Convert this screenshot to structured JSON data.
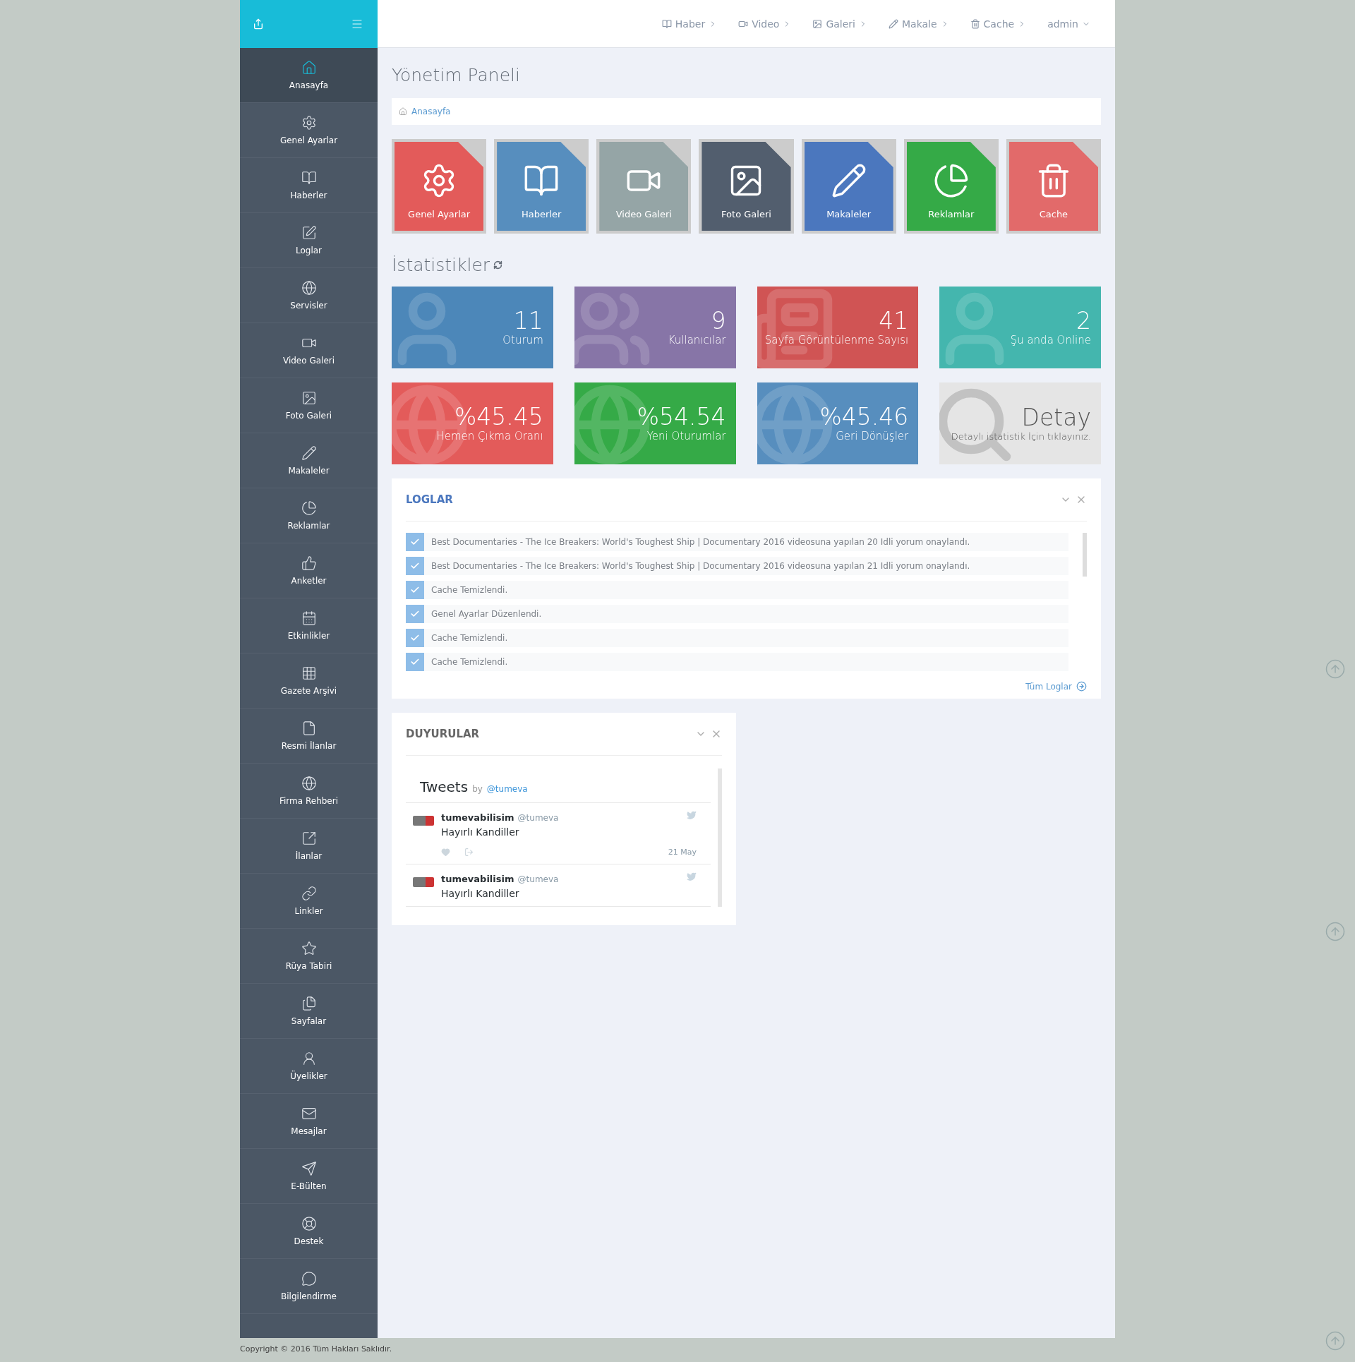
{
  "topnav": [
    {
      "label": "Haber"
    },
    {
      "label": "Video"
    },
    {
      "label": "Galeri"
    },
    {
      "label": "Makale"
    },
    {
      "label": "Cache"
    }
  ],
  "user_menu": {
    "label": "admin"
  },
  "sidebar": {
    "items": [
      {
        "label": "Anasayfa",
        "selected": true
      },
      {
        "label": "Genel Ayarlar",
        "selected": false
      },
      {
        "label": "Haberler",
        "selected": false
      },
      {
        "label": "Loglar",
        "selected": false
      },
      {
        "label": "Servisler",
        "selected": false
      },
      {
        "label": "Video Galeri",
        "selected": false
      },
      {
        "label": "Foto Galeri",
        "selected": false
      },
      {
        "label": "Makaleler",
        "selected": false
      },
      {
        "label": "Reklamlar",
        "selected": false
      },
      {
        "label": "Anketler",
        "selected": false
      },
      {
        "label": "Etkinlikler",
        "selected": false
      },
      {
        "label": "Gazete Arşivi",
        "selected": false
      },
      {
        "label": "Resmi İlanlar",
        "selected": false
      },
      {
        "label": "Firma Rehberi",
        "selected": false
      },
      {
        "label": "İlanlar",
        "selected": false
      },
      {
        "label": "Linkler",
        "selected": false
      },
      {
        "label": "Rüya Tabiri",
        "selected": false
      },
      {
        "label": "Sayfalar",
        "selected": false
      },
      {
        "label": "Üyelikler",
        "selected": false
      },
      {
        "label": "Mesajlar",
        "selected": false
      },
      {
        "label": "E-Bülten",
        "selected": false
      },
      {
        "label": "Destek",
        "selected": false
      },
      {
        "label": "Bilgilendirme",
        "selected": false
      }
    ]
  },
  "page_title": "Yönetim Paneli",
  "breadcrumb": [
    "Anasayfa"
  ],
  "tiles": [
    {
      "label": "Genel Ayarlar",
      "color": "#e35b5a"
    },
    {
      "label": "Haberler",
      "color": "#578ebe"
    },
    {
      "label": "Video Galeri",
      "color": "#95a5a6"
    },
    {
      "label": "Foto Galeri",
      "color": "#525e6e"
    },
    {
      "label": "Makaleler",
      "color": "#4b77be"
    },
    {
      "label": "Reklamlar",
      "color": "#35aa47"
    },
    {
      "label": "Cache",
      "color": "#e26a6a"
    }
  ],
  "stats_title": "İstatistikler",
  "stats": [
    {
      "kind": "metric",
      "value": "11",
      "label": "Oturum",
      "color": "#4c87b9"
    },
    {
      "kind": "metric",
      "value": "9",
      "label": "Kullanıcılar",
      "color": "#8775a7"
    },
    {
      "kind": "metric",
      "value": "41",
      "label": "Sayfa Görüntülenme Sayısı",
      "color": "#d05454"
    },
    {
      "kind": "metric",
      "value": "2",
      "label": "Şu anda Online",
      "color": "#44b6ae"
    },
    {
      "kind": "metric",
      "value": "%45.45",
      "label": "Hemen Çıkma Oranı",
      "color": "#e35b5a"
    },
    {
      "kind": "metric",
      "value": "%54.54",
      "label": "Yeni Oturumlar",
      "color": "#35aa47"
    },
    {
      "kind": "metric",
      "value": "%45.46",
      "label": "Geri Dönüşler",
      "color": "#578ebe"
    },
    {
      "kind": "detail",
      "value": "Detay",
      "label": "Detaylı istatistik İçin tıklayınız.",
      "color": "#e5e5e5"
    }
  ],
  "logs": {
    "title": "LOGLAR",
    "items": [
      {
        "text": "Best Documentaries - The Ice Breakers: World's Toughest Ship | Documentary 2016 videosuna yapılan 20 Idli yorum onaylandı.",
        "checked": true
      },
      {
        "text": "Best Documentaries - The Ice Breakers: World's Toughest Ship | Documentary 2016 videosuna yapılan 21 Idli yorum onaylandı.",
        "checked": true
      },
      {
        "text": "Cache Temizlendi.",
        "checked": true
      },
      {
        "text": "Genel Ayarlar Düzenlendi.",
        "checked": true
      },
      {
        "text": "Cache Temizlendi.",
        "checked": true
      },
      {
        "text": "Cache Temizlendi.",
        "checked": true
      }
    ],
    "link": "Tüm Loglar"
  },
  "announcements": {
    "title": "DUYURULAR",
    "widget_title": "Tweets",
    "by": "by",
    "account": "@tumeva",
    "tweets": [
      {
        "name": "tumevabilisim",
        "handle": "@tumeva",
        "text": "Hayırlı Kandiller",
        "date": "21 May"
      },
      {
        "name": "tumevabilisim",
        "handle": "@tumeva",
        "text": "Hayırlı Kandiller"
      }
    ]
  },
  "footer": "Copyright © 2016 Tüm Hakları Saklıdır."
}
